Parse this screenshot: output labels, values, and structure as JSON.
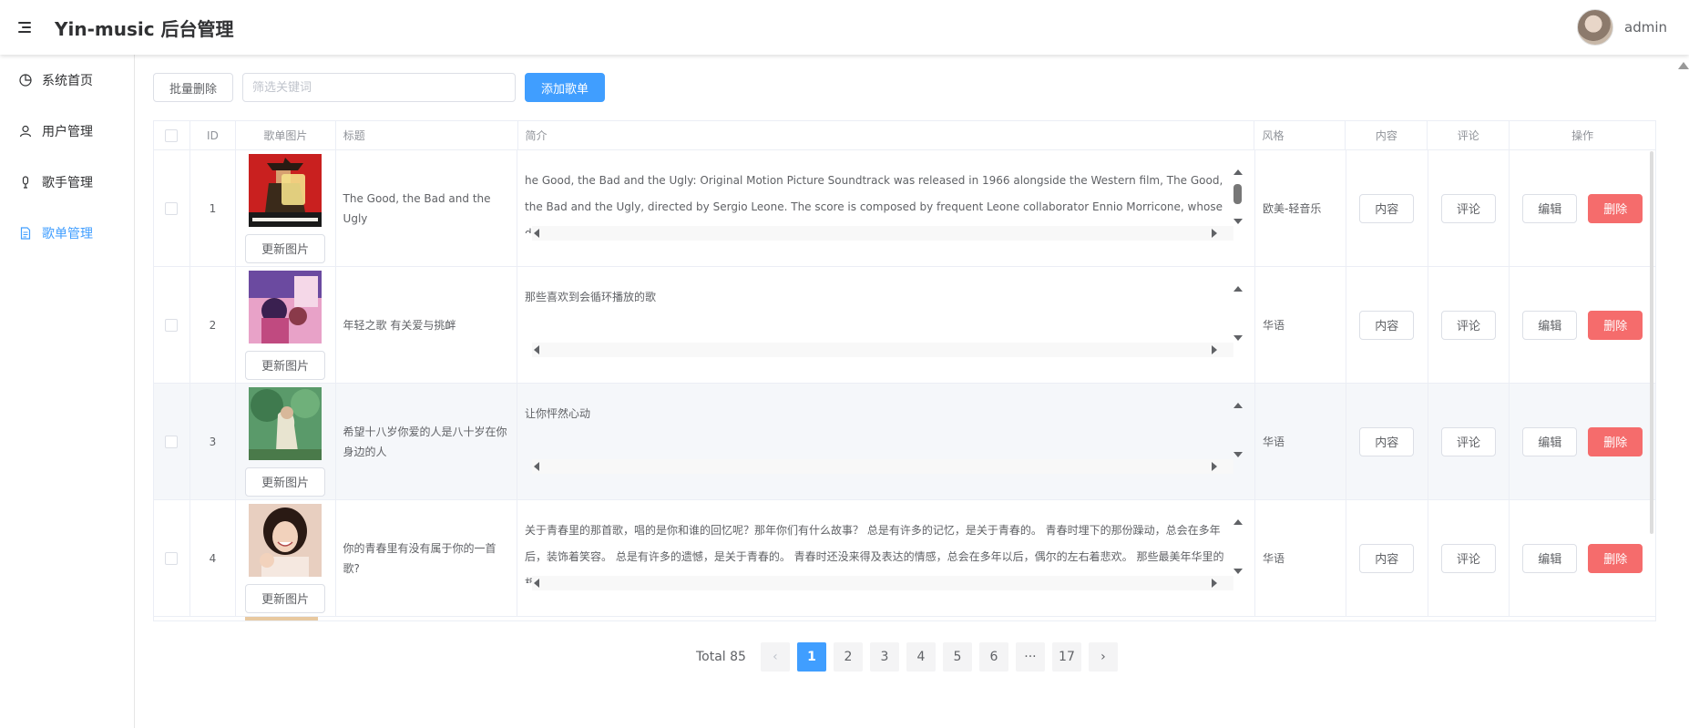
{
  "header": {
    "title": "Yin-music 后台管理",
    "username": "admin",
    "menu_icon": "hamburger-icon",
    "avatar_icon": "user-avatar"
  },
  "sidebar": {
    "items": [
      {
        "label": "系统首页",
        "icon": "pie-chart-icon",
        "active": false
      },
      {
        "label": "用户管理",
        "icon": "user-icon",
        "active": false
      },
      {
        "label": "歌手管理",
        "icon": "microphone-icon",
        "active": false
      },
      {
        "label": "歌单管理",
        "icon": "document-icon",
        "active": true
      }
    ]
  },
  "toolbar": {
    "batch_delete_label": "批量删除",
    "search_placeholder": "筛选关键词",
    "add_label": "添加歌单"
  },
  "table": {
    "columns": [
      "",
      "ID",
      "歌单图片",
      "标题",
      "简介",
      "风格",
      "内容",
      "评论",
      "操作"
    ],
    "update_image_label": "更新图片",
    "content_label": "内容",
    "comment_label": "评论",
    "edit_label": "编辑",
    "delete_label": "删除",
    "rows": [
      {
        "id": "1",
        "title": "The Good, the Bad and the Ugly",
        "intro": "he Good, the Bad and the Ugly: Original Motion Picture Soundtrack was released in 1966 alongside the Western film, The Good, the Bad and the Ugly, directed by Sergio Leone. The score is composed by frequent Leone collaborator Ennio Morricone, whose distinctive original compositions, containing gunfire, whistling, and yodeling permeate the film. The main theme, resembling the howling of a coyote, is a two-note melody that is a frequent motif, and is used for the three main characters, with a different instrument used for each on",
        "style": "欧美-轻音乐",
        "highlight": false
      },
      {
        "id": "2",
        "title": "年轻之歌 有关爱与挑衅",
        "intro": "那些喜欢到会循环播放的歌",
        "style": "华语",
        "highlight": false
      },
      {
        "id": "3",
        "title": "希望十八岁你爱的人是八十岁在你身边的人",
        "intro": "让你怦然心动",
        "style": "华语",
        "highlight": true
      },
      {
        "id": "4",
        "title": "你的青春里有没有属于你的一首歌?",
        "intro": "关于青春里的那首歌，唱的是你和谁的回忆呢？那年你们有什么故事？ 总是有许多的记忆，是关于青春的。 青春时埋下的那份躁动，总会在多年后，装饰着笑容。 总是有许多的遗憾，是关于青春的。 青春时还没来得及表达的情感，总会在多年以后，偶尔的左右着悲欢。 那些最美年华里的相遇，那些青春里的不知所措，都被勾勒成了一幅幅画。 而这些画，只在心情最愉悦时，只在心情最低落时，悄悄的，在内心深处闪过。",
        "style": "华语",
        "highlight": false
      }
    ]
  },
  "pagination": {
    "total_label": "Total 85",
    "pages": [
      "1",
      "2",
      "3",
      "4",
      "5",
      "6",
      "···",
      "17"
    ],
    "current": "1",
    "prev_icon": "chevron-left-icon",
    "next_icon": "chevron-right-icon"
  },
  "colors": {
    "primary": "#409eff",
    "danger": "#f56c6c",
    "border": "#ebeef5"
  }
}
